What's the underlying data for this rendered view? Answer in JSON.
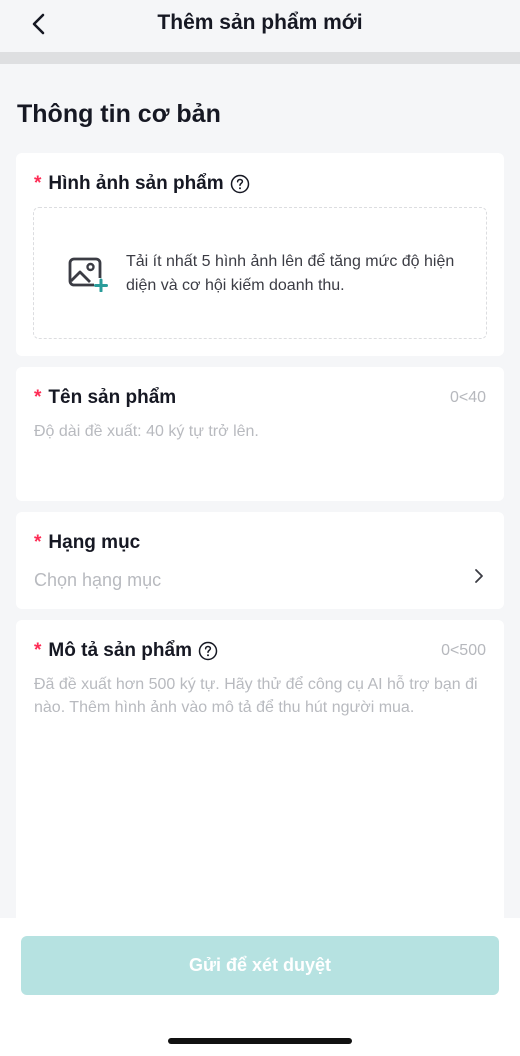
{
  "header": {
    "title": "Thêm sản phẩm mới"
  },
  "section": {
    "title": "Thông tin cơ bản"
  },
  "images": {
    "required_mark": "*",
    "label": "Hình ảnh sản phẩm",
    "upload_hint": "Tải ít nhất 5 hình ảnh lên để tăng mức độ hiện diện và cơ hội kiếm doanh thu."
  },
  "product_name": {
    "required_mark": "*",
    "label": "Tên sản phẩm",
    "counter": "0<40",
    "placeholder": "Độ dài đề xuất: 40 ký tự trở lên."
  },
  "category": {
    "required_mark": "*",
    "label": "Hạng mục",
    "placeholder": "Chọn hạng mục"
  },
  "description": {
    "required_mark": "*",
    "label": "Mô tả sản phẩm",
    "counter": "0<500",
    "placeholder": "Đã đề xuất hơn 500 ký tự. Hãy thử để công cụ AI hỗ trợ bạn đi nào. Thêm hình ảnh vào mô tả để thu hút người mua."
  },
  "footer": {
    "submit_label": "Gửi để xét duyệt"
  },
  "colors": {
    "required": "#fe2c55",
    "submit_disabled": "#b6e2e1",
    "icon_accent": "#2a9c9a",
    "placeholder": "#b8babf"
  },
  "icons": [
    "chevron-left-icon",
    "help-circle-icon",
    "add-image-icon",
    "chevron-right-icon"
  ]
}
